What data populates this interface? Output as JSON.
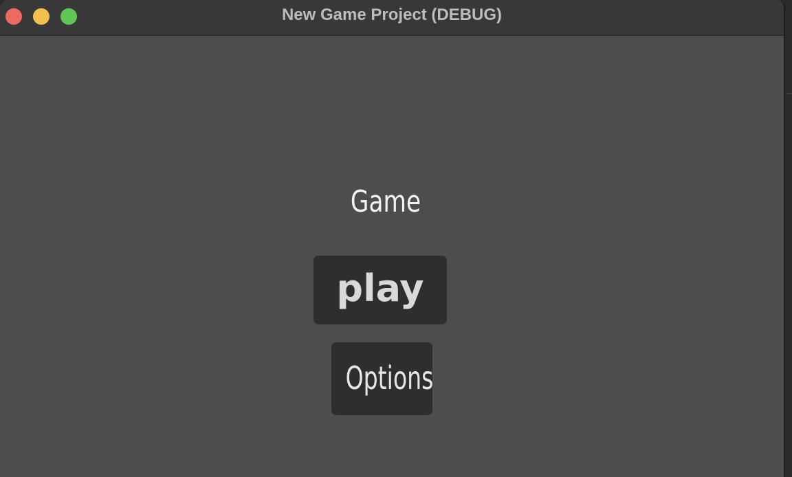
{
  "window": {
    "title": "New Game Project (DEBUG)",
    "controls": [
      "close-icon",
      "minimize-icon",
      "zoom-icon"
    ],
    "colors": {
      "close": "#ed6a5e",
      "minimize": "#f4bf4f",
      "zoom": "#61c554",
      "background": "#4d4d4d",
      "titlebar": "#383838"
    }
  },
  "menu": {
    "title": "Game",
    "play_label": "play",
    "options_label": "Options",
    "button_color": "#2e2e2e"
  }
}
